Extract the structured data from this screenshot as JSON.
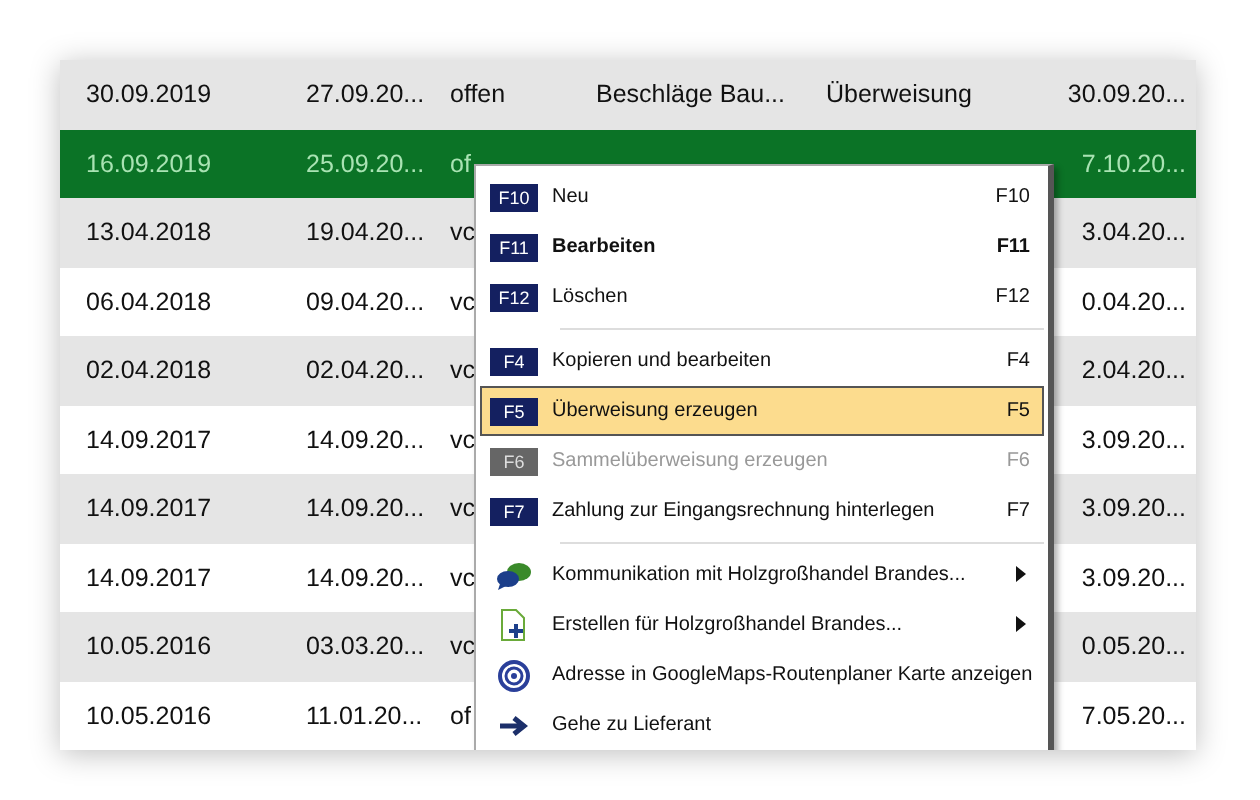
{
  "table": {
    "rows": [
      {
        "selected": false,
        "date_1": "30.09.2019",
        "date_2": "27.09.20...",
        "status": "offen",
        "column_4": "Beschläge Bau...",
        "column_5": "Überweisung",
        "column_6": "30.09.20..."
      },
      {
        "selected": true,
        "date_1": "16.09.2019",
        "date_2": "25.09.20...",
        "status": "of",
        "column_6": "7.10.20..."
      },
      {
        "selected": false,
        "date_1": "13.04.2018",
        "date_2": "19.04.20...",
        "status": "vc",
        "column_6": "3.04.20..."
      },
      {
        "selected": false,
        "date_1": "06.04.2018",
        "date_2": "09.04.20...",
        "status": "vc",
        "column_6": "0.04.20..."
      },
      {
        "selected": false,
        "date_1": "02.04.2018",
        "date_2": "02.04.20...",
        "status": "vc",
        "column_6": "2.04.20..."
      },
      {
        "selected": false,
        "date_1": "14.09.2017",
        "date_2": "14.09.20...",
        "status": "vc",
        "column_6": "3.09.20..."
      },
      {
        "selected": false,
        "date_1": "14.09.2017",
        "date_2": "14.09.20...",
        "status": "vc",
        "column_6": "3.09.20..."
      },
      {
        "selected": false,
        "date_1": "14.09.2017",
        "date_2": "14.09.20...",
        "status": "vc",
        "column_6": "3.09.20..."
      },
      {
        "selected": false,
        "date_1": "10.05.2016",
        "date_2": "03.03.20...",
        "status": "vc",
        "column_6": "0.05.20..."
      },
      {
        "selected": false,
        "date_1": "10.05.2016",
        "date_2": "11.01.20...",
        "status": "of",
        "column_6": "7.05.20..."
      }
    ]
  },
  "context_menu": {
    "items": [
      {
        "kind": "fkey",
        "key": "F10",
        "label": "Neu",
        "shortcut": "F10",
        "default": false,
        "disabled": false,
        "selected": false,
        "submenu": false
      },
      {
        "kind": "fkey",
        "key": "F11",
        "label": "Bearbeiten",
        "shortcut": "F11",
        "default": true,
        "disabled": false,
        "selected": false,
        "submenu": false
      },
      {
        "kind": "fkey",
        "key": "F12",
        "label": "Löschen",
        "shortcut": "F12",
        "default": false,
        "disabled": false,
        "selected": false,
        "submenu": false
      },
      {
        "kind": "separator"
      },
      {
        "kind": "fkey",
        "key": "F4",
        "label": "Kopieren und bearbeiten",
        "shortcut": "F4",
        "default": false,
        "disabled": false,
        "selected": false,
        "submenu": false
      },
      {
        "kind": "fkey",
        "key": "F5",
        "label": "Überweisung erzeugen",
        "shortcut": "F5",
        "default": false,
        "disabled": false,
        "selected": true,
        "submenu": false
      },
      {
        "kind": "fkey",
        "key": "F6",
        "label": "Sammelüberweisung erzeugen",
        "shortcut": "F6",
        "default": false,
        "disabled": true,
        "selected": false,
        "submenu": false
      },
      {
        "kind": "fkey",
        "key": "F7",
        "label": "Zahlung zur Eingangsrechnung hinterlegen",
        "shortcut": "F7",
        "default": false,
        "disabled": false,
        "selected": false,
        "submenu": false
      },
      {
        "kind": "separator"
      },
      {
        "kind": "chat",
        "label": "Kommunikation mit Holzgroßhandel Brandes...",
        "default": false,
        "disabled": false,
        "selected": false,
        "submenu": true
      },
      {
        "kind": "new-doc",
        "label": "Erstellen für Holzgroßhandel Brandes...",
        "default": false,
        "disabled": false,
        "selected": false,
        "submenu": true
      },
      {
        "kind": "target",
        "label": "Adresse in GoogleMaps-Routenplaner Karte anzeigen",
        "default": false,
        "disabled": false,
        "selected": false,
        "submenu": false
      },
      {
        "kind": "goto",
        "label": "Gehe zu Lieferant",
        "default": false,
        "disabled": false,
        "selected": false,
        "submenu": false
      }
    ]
  }
}
